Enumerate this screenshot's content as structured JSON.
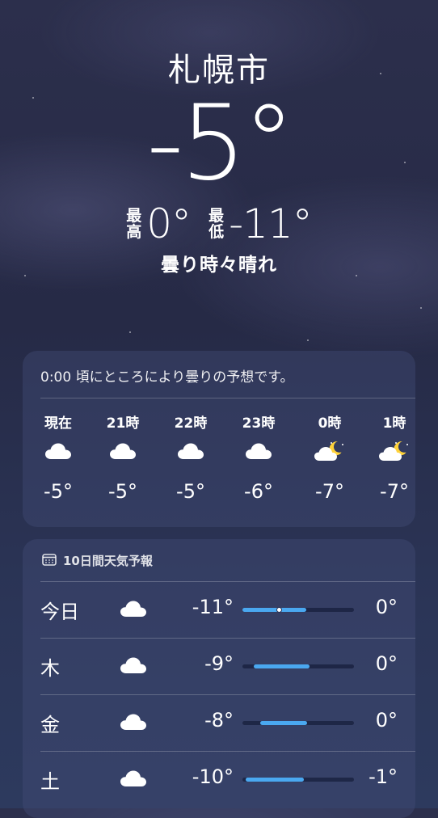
{
  "header": {
    "city": "札幌市",
    "temperature": "-5°",
    "high_label_top": "最",
    "high_label_bottom": "高",
    "high_value": "0°",
    "low_label_top": "最",
    "low_label_bottom": "低",
    "low_value": "-11°",
    "condition": "曇り時々晴れ"
  },
  "hourly": {
    "summary": "0:00 頃にところにより曇りの予想です。",
    "items": [
      {
        "time": "現在",
        "icon": "cloud-icon",
        "temp": "-5°"
      },
      {
        "time": "21時",
        "icon": "cloud-icon",
        "temp": "-5°"
      },
      {
        "time": "22時",
        "icon": "cloud-icon",
        "temp": "-5°"
      },
      {
        "time": "23時",
        "icon": "cloud-icon",
        "temp": "-6°"
      },
      {
        "time": "0時",
        "icon": "moon-cloud-icon",
        "temp": "-7°"
      },
      {
        "time": "1時",
        "icon": "moon-cloud-icon",
        "temp": "-7°"
      }
    ]
  },
  "daily": {
    "title": "10日間天気予報",
    "days": [
      {
        "day": "今日",
        "icon": "cloud-icon",
        "low": "-11°",
        "high": "0°",
        "bar_start": 0.0,
        "bar_end": 0.57,
        "current_marker": 0.33
      },
      {
        "day": "木",
        "icon": "cloud-icon",
        "low": "-9°",
        "high": "0°",
        "bar_start": 0.1,
        "bar_end": 0.6
      },
      {
        "day": "金",
        "icon": "cloud-icon",
        "low": "-8°",
        "high": "0°",
        "bar_start": 0.16,
        "bar_end": 0.58
      },
      {
        "day": "土",
        "icon": "cloud-icon",
        "low": "-10°",
        "high": "-1°",
        "bar_start": 0.03,
        "bar_end": 0.55
      }
    ]
  },
  "colors": {
    "bar_fill": "#4aa8f0",
    "background_top": "#2c2f4c",
    "background_bottom": "#2d3a5e"
  }
}
